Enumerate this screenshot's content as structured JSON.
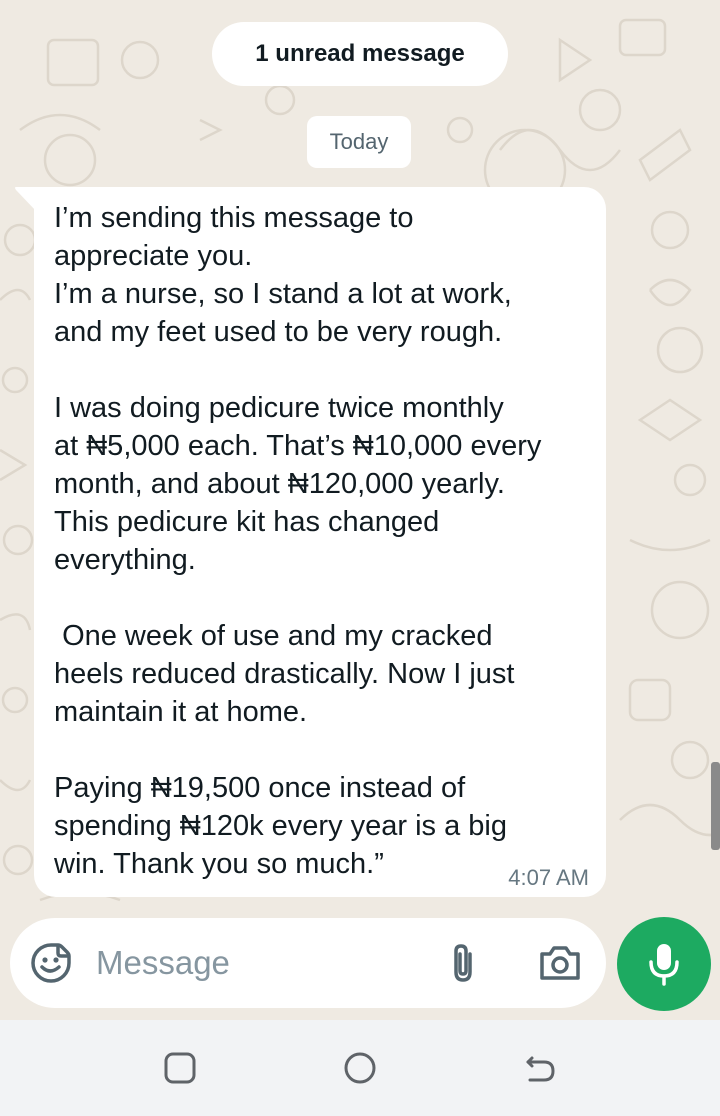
{
  "unread_banner": "1 unread message",
  "date_divider": "Today",
  "message": {
    "text": "I’m sending this message to\nappreciate you.\nI’m a nurse, so I stand a lot at work,\nand my feet used to be very rough.\n\nI was doing pedicure twice monthly\nat ₦5,000 each. That’s ₦10,000 every\nmonth, and about ₦120,000 yearly.\nThis pedicure kit has changed\neverything.\n\n One week of use and my cracked\nheels reduced drastically. Now I just\nmaintain it at home.\n\nPaying ₦19,500 once instead of\nspending ₦120k every year is a big\nwin. Thank you so much.”",
    "time": "4:07 AM"
  },
  "composer": {
    "placeholder": "Message",
    "icons": [
      "sticker-smiley-icon",
      "paperclip-icon",
      "camera-icon",
      "microphone-icon"
    ]
  },
  "navigation": {
    "icons": [
      "recent-apps-icon",
      "home-icon",
      "back-icon"
    ]
  },
  "colors": {
    "wallpaper": "#efeae2",
    "bubble": "#ffffff",
    "mic_button": "#1daa61",
    "icon_gray": "#54656f"
  }
}
